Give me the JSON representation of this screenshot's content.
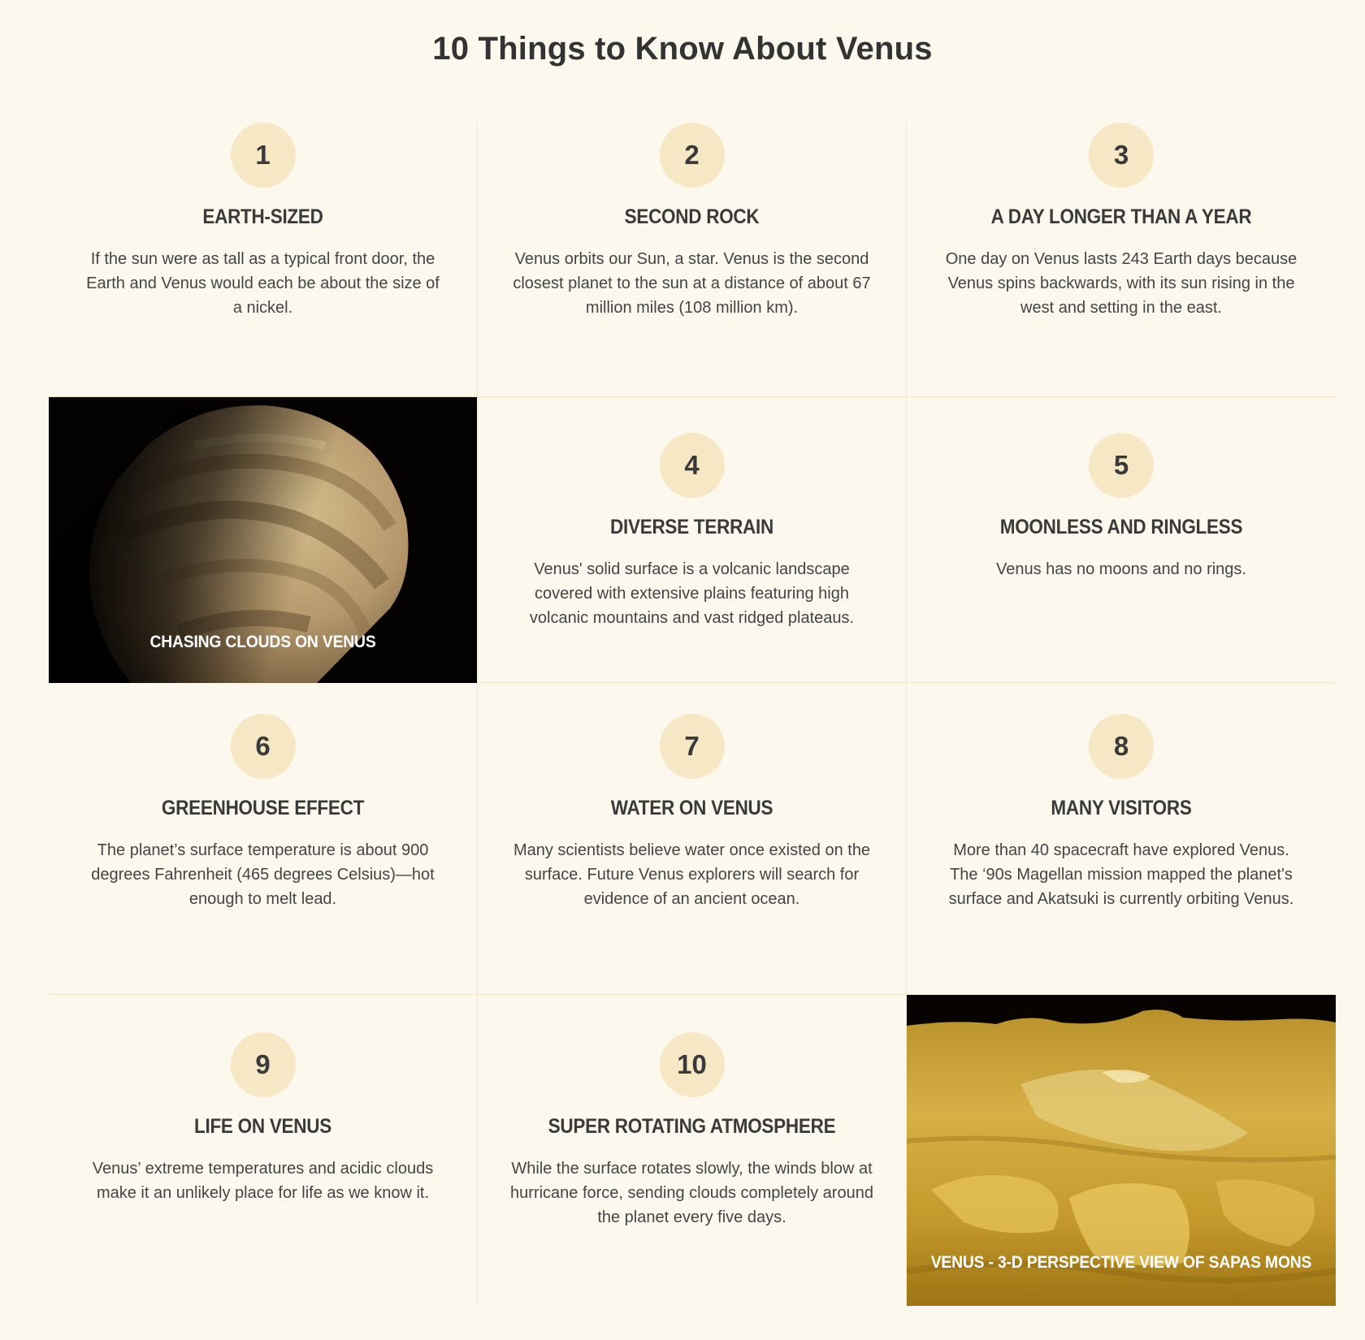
{
  "page": {
    "title": "10 Things to Know About Venus"
  },
  "facts": [
    {
      "number": "1",
      "title": "EARTH-SIZED",
      "text": "If the sun were as tall as a typical front door, the Earth and Venus would each be about the size of a nickel."
    },
    {
      "number": "2",
      "title": "SECOND ROCK",
      "text": "Venus orbits our Sun, a star. Venus is the second closest planet to the sun at a distance of about 67 million miles (108 million km)."
    },
    {
      "number": "3",
      "title": "A DAY LONGER THAN A YEAR",
      "text": "One day on Venus lasts 243 Earth days because Venus spins backwards, with its sun rising in the west and setting in the east."
    },
    {
      "number": "4",
      "title": "DIVERSE TERRAIN",
      "text": "Venus' solid surface is a volcanic landscape covered with extensive plains featuring high volcanic mountains and vast ridged plateaus."
    },
    {
      "number": "5",
      "title": "MOONLESS AND RINGLESS",
      "text": "Venus has no moons and no rings."
    },
    {
      "number": "6",
      "title": "GREENHOUSE EFFECT",
      "text": "The planet’s surface temperature is about 900 degrees Fahrenheit (465 degrees Celsius)—hot enough to melt lead."
    },
    {
      "number": "7",
      "title": "WATER ON VENUS",
      "text": "Many scientists believe water once existed on the surface. Future Venus explorers will search for evidence of an ancient ocean."
    },
    {
      "number": "8",
      "title": "MANY VISITORS",
      "text": "More than 40 spacecraft have explored Venus. The ‘90s Magellan mission mapped the planet's surface and Akatsuki is currently orbiting Venus."
    },
    {
      "number": "9",
      "title": "LIFE ON VENUS",
      "text": "Venus’ extreme temperatures and acidic clouds make it an unlikely place for life as we know it."
    },
    {
      "number": "10",
      "title": "SUPER ROTATING ATMOSPHERE",
      "text": "While the surface rotates slowly, the winds blow at hurricane force, sending clouds completely around the planet every five days."
    }
  ],
  "images": {
    "clouds": {
      "caption": "CHASING CLOUDS ON VENUS"
    },
    "sapas": {
      "caption": "VENUS - 3-D PERSPECTIVE VIEW OF SAPAS MONS"
    }
  },
  "colors": {
    "background": "#fcf8ee",
    "circle": "#f6e8c4",
    "divider": "#f5e8c7",
    "text": "#3a3a3a"
  }
}
